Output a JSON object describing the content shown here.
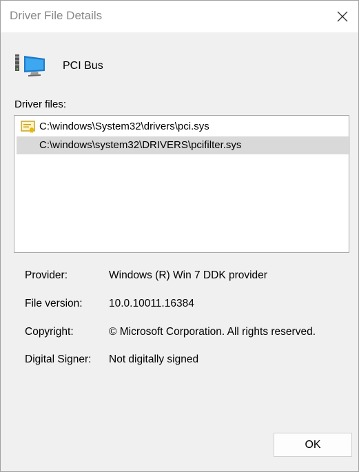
{
  "window": {
    "title": "Driver File Details"
  },
  "device": {
    "name": "PCI Bus"
  },
  "files": {
    "label": "Driver files:",
    "items": [
      "C:\\windows\\System32\\drivers\\pci.sys",
      "C:\\windows\\system32\\DRIVERS\\pcifilter.sys"
    ]
  },
  "info": {
    "provider_label": "Provider:",
    "provider_value": "Windows (R) Win 7 DDK provider",
    "version_label": "File version:",
    "version_value": "10.0.10011.16384",
    "copyright_label": "Copyright:",
    "copyright_value": "© Microsoft Corporation. All rights reserved.",
    "signer_label": "Digital Signer:",
    "signer_value": "Not digitally signed"
  },
  "buttons": {
    "ok": "OK"
  },
  "icons": {
    "close": "close-icon",
    "device": "pci-device-icon",
    "file": "certificate-file-icon"
  },
  "colors": {
    "selected_row": "#d9d9d9",
    "title_text": "#888888",
    "dialog_bg": "#f0f0f0"
  }
}
